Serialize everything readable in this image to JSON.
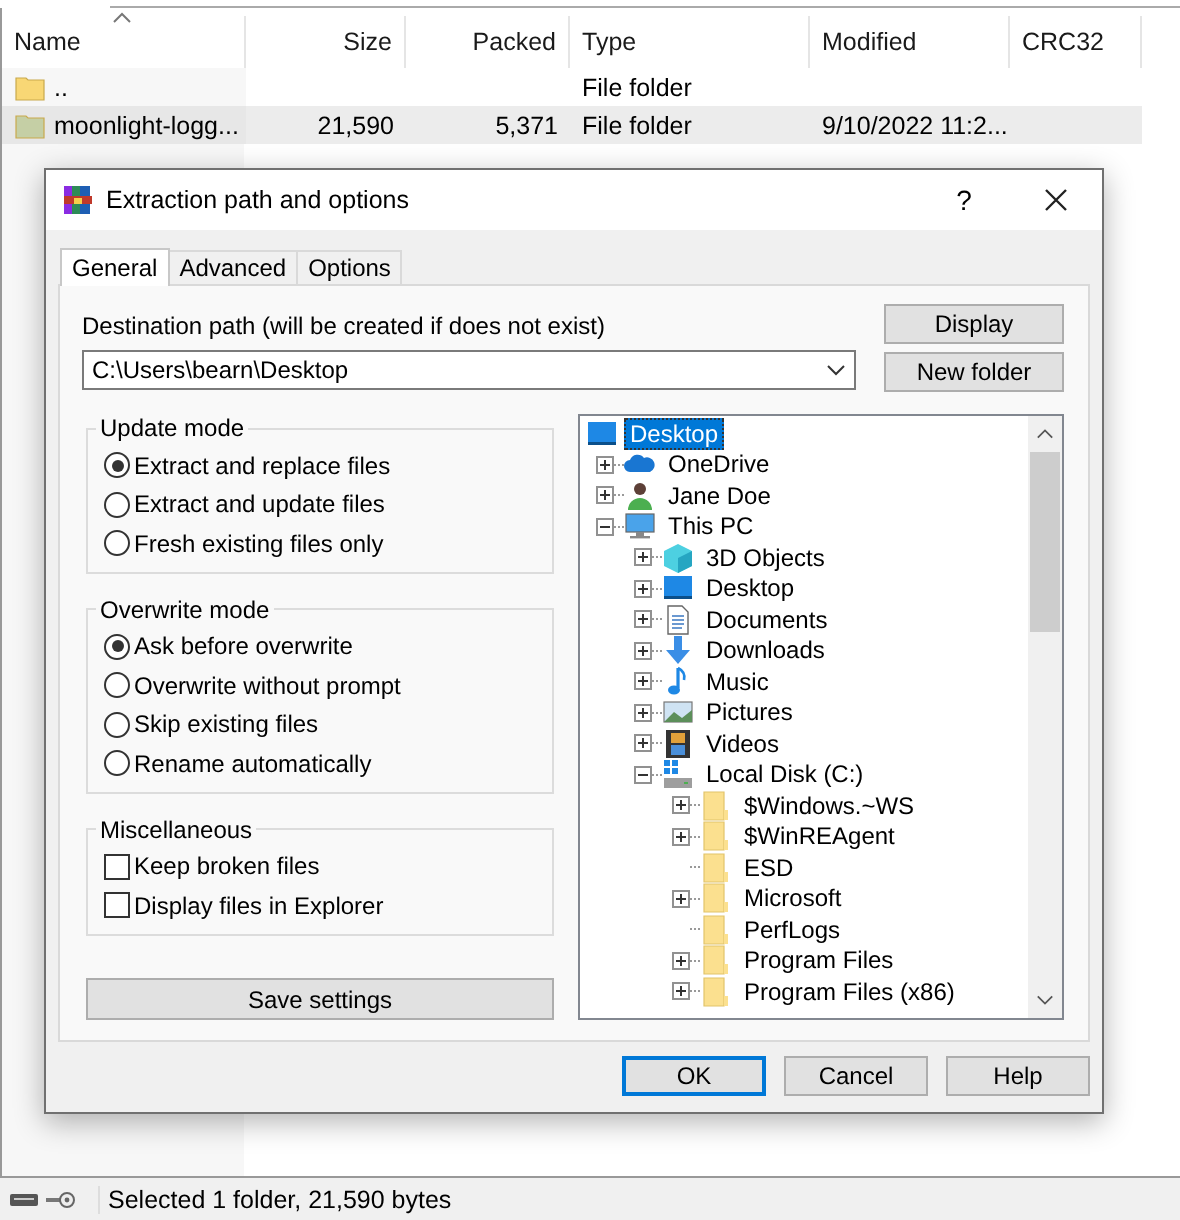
{
  "file_list": {
    "columns": [
      "Name",
      "Size",
      "Packed",
      "Type",
      "Modified",
      "CRC32"
    ],
    "rows": [
      {
        "cells": [
          "..",
          "",
          "",
          "File folder",
          "",
          ""
        ],
        "selected": false
      },
      {
        "cells": [
          "moonlight-logg...",
          "21,590",
          "5,371",
          "File folder",
          "9/10/2022 11:2...",
          ""
        ],
        "selected": true
      }
    ]
  },
  "dialog": {
    "title": "Extraction path and options",
    "help": "?",
    "tabs": [
      {
        "label": "General",
        "selected": true
      },
      {
        "label": "Advanced",
        "selected": false
      },
      {
        "label": "Options",
        "selected": false
      }
    ],
    "destination": {
      "label": "Destination path (will be created if does not exist)",
      "value": "C:\\Users\\bearn\\Desktop"
    },
    "side_buttons": [
      "Display",
      "New folder"
    ],
    "groups": [
      {
        "title": "Update mode",
        "kind": "radio",
        "options": [
          {
            "label": "Extract and replace files",
            "selected": true
          },
          {
            "label": "Extract and update files",
            "selected": false
          },
          {
            "label": "Fresh existing files only",
            "selected": false
          }
        ]
      },
      {
        "title": "Overwrite mode",
        "kind": "radio",
        "options": [
          {
            "label": "Ask before overwrite",
            "selected": true
          },
          {
            "label": "Overwrite without prompt",
            "selected": false
          },
          {
            "label": "Skip existing files",
            "selected": false
          },
          {
            "label": "Rename automatically",
            "selected": false
          }
        ]
      },
      {
        "title": "Miscellaneous",
        "kind": "check",
        "options": [
          {
            "label": "Keep broken files",
            "checked": false
          },
          {
            "label": "Display files in Explorer",
            "checked": false
          }
        ]
      }
    ],
    "save_button": "Save settings",
    "tree": [
      {
        "label": "Desktop",
        "kind": "desktop",
        "selected": true,
        "children": [
          {
            "label": "OneDrive",
            "kind": "cloud",
            "selected": false,
            "expandable": true,
            "expanded": false
          },
          {
            "label": "Jane Doe",
            "kind": "user",
            "selected": false,
            "expandable": true,
            "expanded": false
          },
          {
            "label": "This PC",
            "kind": "pc",
            "selected": false,
            "expandable": true,
            "expanded": true,
            "children": [
              {
                "label": "3D Objects",
                "kind": "cube",
                "selected": false,
                "expandable": true,
                "expanded": false
              },
              {
                "label": "Desktop",
                "kind": "desktop",
                "selected": false,
                "expandable": true,
                "expanded": false
              },
              {
                "label": "Documents",
                "kind": "document",
                "selected": false,
                "expandable": true,
                "expanded": false
              },
              {
                "label": "Downloads",
                "kind": "download",
                "selected": false,
                "expandable": true,
                "expanded": false
              },
              {
                "label": "Music",
                "kind": "music",
                "selected": false,
                "expandable": true,
                "expanded": false
              },
              {
                "label": "Pictures",
                "kind": "pictures",
                "selected": false,
                "expandable": true,
                "expanded": false
              },
              {
                "label": "Videos",
                "kind": "videos",
                "selected": false,
                "expandable": true,
                "expanded": false
              },
              {
                "label": "Local Disk (C:)",
                "kind": "disk",
                "selected": false,
                "expandable": true,
                "expanded": true,
                "children": [
                  {
                    "label": "$Windows.~WS",
                    "kind": "folder",
                    "selected": false,
                    "expandable": true,
                    "expanded": false
                  },
                  {
                    "label": "$WinREAgent",
                    "kind": "folder",
                    "selected": false,
                    "expandable": true,
                    "expanded": false
                  },
                  {
                    "label": "ESD",
                    "kind": "folder",
                    "selected": false,
                    "expandable": false
                  },
                  {
                    "label": "Microsoft",
                    "kind": "folder",
                    "selected": false,
                    "expandable": true,
                    "expanded": false
                  },
                  {
                    "label": "PerfLogs",
                    "kind": "folder",
                    "selected": false,
                    "expandable": false
                  },
                  {
                    "label": "Program Files",
                    "kind": "folder",
                    "selected": false,
                    "expandable": true,
                    "expanded": false
                  },
                  {
                    "label": "Program Files (x86)",
                    "kind": "folder",
                    "selected": false,
                    "expandable": true,
                    "expanded": false
                  }
                ]
              }
            ]
          }
        ]
      }
    ],
    "buttons": [
      {
        "label": "OK",
        "kind": "default"
      },
      {
        "label": "Cancel",
        "kind": "normal"
      },
      {
        "label": "Help",
        "kind": "normal"
      }
    ]
  },
  "status_bar": {
    "text": "Selected 1 folder, 21,590 bytes"
  }
}
